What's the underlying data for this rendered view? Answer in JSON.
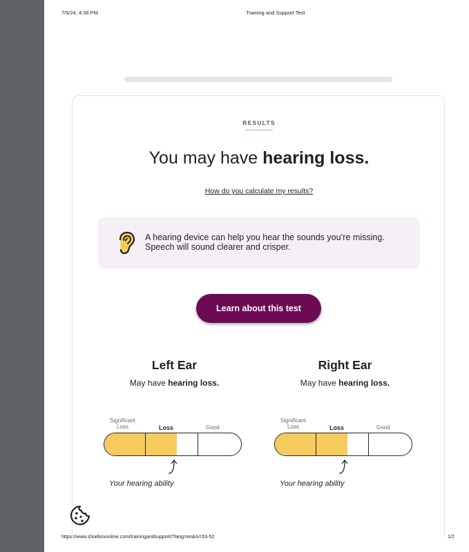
{
  "print_header": {
    "date": "7/5/24, 4:36 PM",
    "title": "Training and Support Test"
  },
  "print_footer": {
    "url": "https://www.shoeboxonline.com/trainingandsupport/?lang=en&rv=53-52",
    "page": "1/2"
  },
  "progress": {
    "fraction": 1.0
  },
  "results": {
    "label": "RESULTS",
    "headline_prefix": "You may have ",
    "headline_bold": "hearing loss.",
    "calc_link": "How do you calculate my results?",
    "info": {
      "icon": "ear-icon",
      "text": "A hearing device can help you hear the sounds you’re missing. Speech will sound clearer and crisper."
    },
    "learn_button": "Learn about this test"
  },
  "ears": [
    {
      "title": "Left Ear",
      "sub_prefix": "May have ",
      "sub_bold": "hearing loss.",
      "scale_labels": {
        "significant": "Significant\nLoss",
        "loss": "Loss",
        "good": "Good"
      },
      "fill_fraction": 0.53,
      "ability_label": "Your hearing ability"
    },
    {
      "title": "Right Ear",
      "sub_prefix": "May have ",
      "sub_bold": "hearing loss.",
      "scale_labels": {
        "significant": "Significant\nLoss",
        "loss": "Loss",
        "good": "Good"
      },
      "fill_fraction": 0.53,
      "ability_label": "Your hearing ability"
    }
  ],
  "cookie": {
    "icon": "cookie-icon"
  },
  "colors": {
    "brand": "#6c0a56",
    "meter_fill": "#f6cb5d",
    "info_bg": "#f5eff6",
    "sidebar": "#5f6368"
  }
}
